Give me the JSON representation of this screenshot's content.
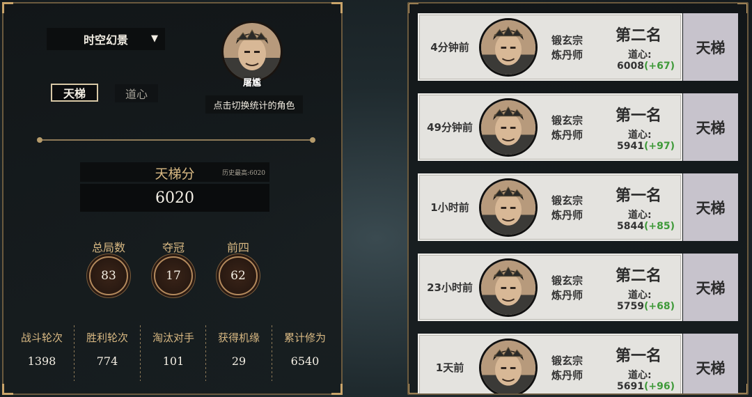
{
  "left": {
    "mode_dropdown": "时空幻景",
    "tabs": [
      "天梯",
      "道心"
    ],
    "character_name": "屠尷",
    "switch_hint": "点击切换统计的角色",
    "ladder_label": "天梯分",
    "history_best": "历史最高:6020",
    "ladder_score": "6020",
    "stats": [
      {
        "label": "总局数",
        "value": "83"
      },
      {
        "label": "夺冠",
        "value": "17"
      },
      {
        "label": "前四",
        "value": "62"
      }
    ],
    "bottom_stats": [
      {
        "label": "战斗轮次",
        "value": "1398"
      },
      {
        "label": "胜利轮次",
        "value": "774"
      },
      {
        "label": "淘汰对手",
        "value": "101"
      },
      {
        "label": "获得机缘",
        "value": "29"
      },
      {
        "label": "累计修为",
        "value": "6540"
      }
    ]
  },
  "matches": [
    {
      "time": "4分钟前",
      "sect": "锻玄宗",
      "role": "炼丹师",
      "rank": "第二名",
      "dx_label": "道心:",
      "dx": "6008",
      "delta": "(+67)",
      "mode": "天梯"
    },
    {
      "time": "49分钟前",
      "sect": "锻玄宗",
      "role": "炼丹师",
      "rank": "第一名",
      "dx_label": "道心:",
      "dx": "5941",
      "delta": "(+97)",
      "mode": "天梯"
    },
    {
      "time": "1小时前",
      "sect": "锻玄宗",
      "role": "炼丹师",
      "rank": "第一名",
      "dx_label": "道心:",
      "dx": "5844",
      "delta": "(+85)",
      "mode": "天梯"
    },
    {
      "time": "23小时前",
      "sect": "锻玄宗",
      "role": "炼丹师",
      "rank": "第二名",
      "dx_label": "道心:",
      "dx": "5759",
      "delta": "(+68)",
      "mode": "天梯"
    },
    {
      "time": "1天前",
      "sect": "锻玄宗",
      "role": "炼丹师",
      "rank": "第一名",
      "dx_label": "道心:",
      "dx": "5691",
      "delta": "(+96)",
      "mode": "天梯"
    }
  ],
  "colors": {
    "gold": "#d9b983",
    "delta_green": "#3f9a3a",
    "frame": "#6b5a3e"
  }
}
